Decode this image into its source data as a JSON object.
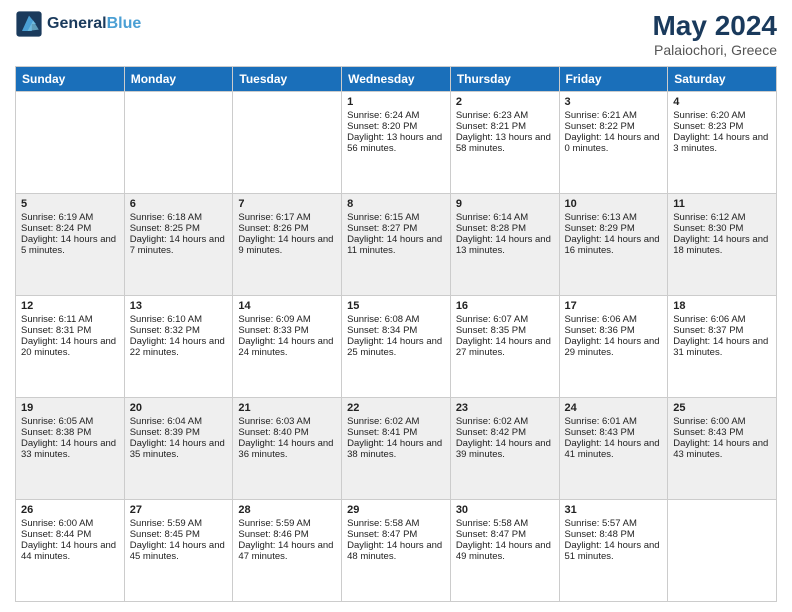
{
  "header": {
    "logo_text_general": "General",
    "logo_text_blue": "Blue",
    "month_year": "May 2024",
    "location": "Palaiochori, Greece"
  },
  "days_of_week": [
    "Sunday",
    "Monday",
    "Tuesday",
    "Wednesday",
    "Thursday",
    "Friday",
    "Saturday"
  ],
  "weeks": [
    {
      "days": [
        {
          "num": "",
          "sunrise": "",
          "sunset": "",
          "daylight": ""
        },
        {
          "num": "",
          "sunrise": "",
          "sunset": "",
          "daylight": ""
        },
        {
          "num": "",
          "sunrise": "",
          "sunset": "",
          "daylight": ""
        },
        {
          "num": "1",
          "sunrise": "Sunrise: 6:24 AM",
          "sunset": "Sunset: 8:20 PM",
          "daylight": "Daylight: 13 hours and 56 minutes."
        },
        {
          "num": "2",
          "sunrise": "Sunrise: 6:23 AM",
          "sunset": "Sunset: 8:21 PM",
          "daylight": "Daylight: 13 hours and 58 minutes."
        },
        {
          "num": "3",
          "sunrise": "Sunrise: 6:21 AM",
          "sunset": "Sunset: 8:22 PM",
          "daylight": "Daylight: 14 hours and 0 minutes."
        },
        {
          "num": "4",
          "sunrise": "Sunrise: 6:20 AM",
          "sunset": "Sunset: 8:23 PM",
          "daylight": "Daylight: 14 hours and 3 minutes."
        }
      ]
    },
    {
      "days": [
        {
          "num": "5",
          "sunrise": "Sunrise: 6:19 AM",
          "sunset": "Sunset: 8:24 PM",
          "daylight": "Daylight: 14 hours and 5 minutes."
        },
        {
          "num": "6",
          "sunrise": "Sunrise: 6:18 AM",
          "sunset": "Sunset: 8:25 PM",
          "daylight": "Daylight: 14 hours and 7 minutes."
        },
        {
          "num": "7",
          "sunrise": "Sunrise: 6:17 AM",
          "sunset": "Sunset: 8:26 PM",
          "daylight": "Daylight: 14 hours and 9 minutes."
        },
        {
          "num": "8",
          "sunrise": "Sunrise: 6:15 AM",
          "sunset": "Sunset: 8:27 PM",
          "daylight": "Daylight: 14 hours and 11 minutes."
        },
        {
          "num": "9",
          "sunrise": "Sunrise: 6:14 AM",
          "sunset": "Sunset: 8:28 PM",
          "daylight": "Daylight: 14 hours and 13 minutes."
        },
        {
          "num": "10",
          "sunrise": "Sunrise: 6:13 AM",
          "sunset": "Sunset: 8:29 PM",
          "daylight": "Daylight: 14 hours and 16 minutes."
        },
        {
          "num": "11",
          "sunrise": "Sunrise: 6:12 AM",
          "sunset": "Sunset: 8:30 PM",
          "daylight": "Daylight: 14 hours and 18 minutes."
        }
      ]
    },
    {
      "days": [
        {
          "num": "12",
          "sunrise": "Sunrise: 6:11 AM",
          "sunset": "Sunset: 8:31 PM",
          "daylight": "Daylight: 14 hours and 20 minutes."
        },
        {
          "num": "13",
          "sunrise": "Sunrise: 6:10 AM",
          "sunset": "Sunset: 8:32 PM",
          "daylight": "Daylight: 14 hours and 22 minutes."
        },
        {
          "num": "14",
          "sunrise": "Sunrise: 6:09 AM",
          "sunset": "Sunset: 8:33 PM",
          "daylight": "Daylight: 14 hours and 24 minutes."
        },
        {
          "num": "15",
          "sunrise": "Sunrise: 6:08 AM",
          "sunset": "Sunset: 8:34 PM",
          "daylight": "Daylight: 14 hours and 25 minutes."
        },
        {
          "num": "16",
          "sunrise": "Sunrise: 6:07 AM",
          "sunset": "Sunset: 8:35 PM",
          "daylight": "Daylight: 14 hours and 27 minutes."
        },
        {
          "num": "17",
          "sunrise": "Sunrise: 6:06 AM",
          "sunset": "Sunset: 8:36 PM",
          "daylight": "Daylight: 14 hours and 29 minutes."
        },
        {
          "num": "18",
          "sunrise": "Sunrise: 6:06 AM",
          "sunset": "Sunset: 8:37 PM",
          "daylight": "Daylight: 14 hours and 31 minutes."
        }
      ]
    },
    {
      "days": [
        {
          "num": "19",
          "sunrise": "Sunrise: 6:05 AM",
          "sunset": "Sunset: 8:38 PM",
          "daylight": "Daylight: 14 hours and 33 minutes."
        },
        {
          "num": "20",
          "sunrise": "Sunrise: 6:04 AM",
          "sunset": "Sunset: 8:39 PM",
          "daylight": "Daylight: 14 hours and 35 minutes."
        },
        {
          "num": "21",
          "sunrise": "Sunrise: 6:03 AM",
          "sunset": "Sunset: 8:40 PM",
          "daylight": "Daylight: 14 hours and 36 minutes."
        },
        {
          "num": "22",
          "sunrise": "Sunrise: 6:02 AM",
          "sunset": "Sunset: 8:41 PM",
          "daylight": "Daylight: 14 hours and 38 minutes."
        },
        {
          "num": "23",
          "sunrise": "Sunrise: 6:02 AM",
          "sunset": "Sunset: 8:42 PM",
          "daylight": "Daylight: 14 hours and 39 minutes."
        },
        {
          "num": "24",
          "sunrise": "Sunrise: 6:01 AM",
          "sunset": "Sunset: 8:43 PM",
          "daylight": "Daylight: 14 hours and 41 minutes."
        },
        {
          "num": "25",
          "sunrise": "Sunrise: 6:00 AM",
          "sunset": "Sunset: 8:43 PM",
          "daylight": "Daylight: 14 hours and 43 minutes."
        }
      ]
    },
    {
      "days": [
        {
          "num": "26",
          "sunrise": "Sunrise: 6:00 AM",
          "sunset": "Sunset: 8:44 PM",
          "daylight": "Daylight: 14 hours and 44 minutes."
        },
        {
          "num": "27",
          "sunrise": "Sunrise: 5:59 AM",
          "sunset": "Sunset: 8:45 PM",
          "daylight": "Daylight: 14 hours and 45 minutes."
        },
        {
          "num": "28",
          "sunrise": "Sunrise: 5:59 AM",
          "sunset": "Sunset: 8:46 PM",
          "daylight": "Daylight: 14 hours and 47 minutes."
        },
        {
          "num": "29",
          "sunrise": "Sunrise: 5:58 AM",
          "sunset": "Sunset: 8:47 PM",
          "daylight": "Daylight: 14 hours and 48 minutes."
        },
        {
          "num": "30",
          "sunrise": "Sunrise: 5:58 AM",
          "sunset": "Sunset: 8:47 PM",
          "daylight": "Daylight: 14 hours and 49 minutes."
        },
        {
          "num": "31",
          "sunrise": "Sunrise: 5:57 AM",
          "sunset": "Sunset: 8:48 PM",
          "daylight": "Daylight: 14 hours and 51 minutes."
        },
        {
          "num": "",
          "sunrise": "",
          "sunset": "",
          "daylight": ""
        }
      ]
    }
  ]
}
